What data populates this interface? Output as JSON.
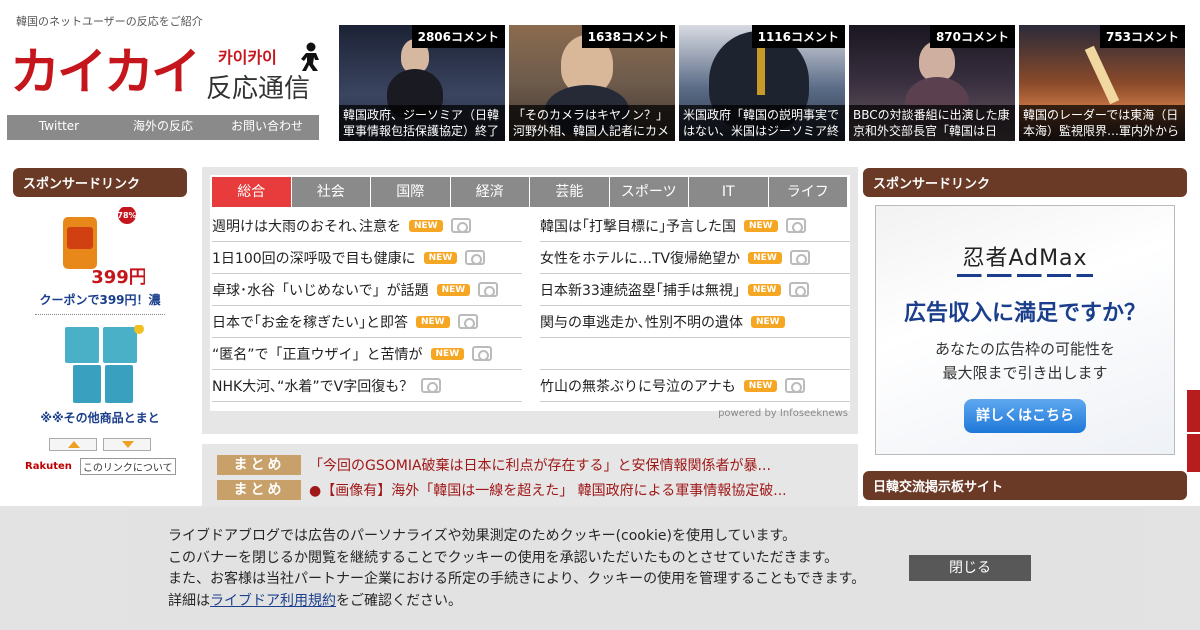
{
  "site": {
    "tagline": "韓国のネットユーザーの反応をご紹介",
    "logo_main": "カイカイ",
    "logo_kana": "카이카이",
    "logo_sub": "反応通信"
  },
  "topnav": [
    "Twitter",
    "海外の反応",
    "お問い合わせ"
  ],
  "thumbnails": [
    {
      "count": "2806コメント",
      "caption": "韓国政府、ジーソミア（日韓軍事情報包括保護協定）終了"
    },
    {
      "count": "1638コメント",
      "caption": "「そのカメラはキヤノン？」河野外相、韓国人記者にカメ"
    },
    {
      "count": "1116コメント",
      "caption": "米国政府「韓国の説明事実ではない、米国はジーソミア終"
    },
    {
      "count": "870コメント",
      "caption": "BBCの対談番組に出演した康京和外交部長官「韓国は日"
    },
    {
      "count": "753コメント",
      "caption": "韓国のレーダーでは東海（日本海）監視限界…軍内外から"
    }
  ],
  "left_sidebar": {
    "heading": "スポンサードリンク",
    "badge": "78%",
    "price": "399円",
    "product1": "クーポンで399円！濃",
    "product2": "※※その他商品とまと",
    "rakuten": "Rakuten",
    "link_about": "このリンクについて"
  },
  "news": {
    "tabs": [
      "総合",
      "社会",
      "国際",
      "経済",
      "芸能",
      "スポーツ",
      "IT",
      "ライフ"
    ],
    "active_tab": "総合",
    "new_label": "NEW",
    "left": [
      {
        "title": "週明けは大雨のおそれ､注意を",
        "new": true,
        "photo": true
      },
      {
        "title": "1日100回の深呼吸で目も健康に",
        "new": true,
        "photo": true
      },
      {
        "title": "卓球･水谷「いじめないで」が話題",
        "new": true,
        "photo": true
      },
      {
        "title": "日本で｢お金を稼ぎたい｣と即答",
        "new": true,
        "photo": true
      },
      {
        "title": "“匿名”で「正直ウザイ」と苦情が",
        "new": true,
        "photo": true
      },
      {
        "title": "NHK大河､“水着”でV字回復も？",
        "new": false,
        "photo": true
      }
    ],
    "right": [
      {
        "title": "韓国は｢打撃目標に｣予言した国",
        "new": true,
        "photo": true
      },
      {
        "title": "女性をホテルに…TV復帰絶望か",
        "new": true,
        "photo": true
      },
      {
        "title": "日本新33連続盗塁｢捕手は無視｣",
        "new": true,
        "photo": true
      },
      {
        "title": "関与の車逃走か､性別不明の遺体",
        "new": true,
        "photo": false
      },
      {
        "title": "",
        "new": false,
        "photo": false
      },
      {
        "title": "竹山の無茶ぶりに号泣のアナも",
        "new": true,
        "photo": true
      }
    ],
    "powered_by": "powered by Infoseeknews"
  },
  "matome": {
    "tag": "まとめ",
    "items": [
      "「今回のGSOMIA破棄は日本に利点が存在する」と安保情報関係者が暴...",
      "●【画像有】海外「韓国は一線を超えた」 韓国政府による軍事情報協定破..."
    ]
  },
  "right_sidebar": {
    "heading": "スポンサードリンク",
    "ad_logo": "忍者AdMax",
    "ad_headline": "広告収入に満足ですか？",
    "ad_sub1": "あなたの広告枠の可能性を",
    "ad_sub2": "最大限まで引き出します",
    "ad_button": "詳しくはこちら",
    "heading2": "日韓交流掲示板サイト"
  },
  "cookie": {
    "line1": "ライブドアブログでは広告のパーソナライズや効果測定のためクッキー(cookie)を使用しています。",
    "line2": "このバナーを閉じるか閲覧を継続することでクッキーの使用を承認いただいたものとさせていただきます。",
    "line3": "また、お客様は当社パートナー企業における所定の手続きにより、クッキーの使用を管理することもできます。",
    "line4_prefix": "詳細は",
    "line4_link": "ライブドア利用規約",
    "line4_suffix": "をご確認ください。",
    "close": "閉じる"
  },
  "colors": {
    "brand_red": "#c4161c",
    "sidebar_head": "#6b3a26",
    "active_tab": "#e83c3c",
    "new_badge": "#f5a623",
    "matome_tag": "#c8a06a"
  }
}
